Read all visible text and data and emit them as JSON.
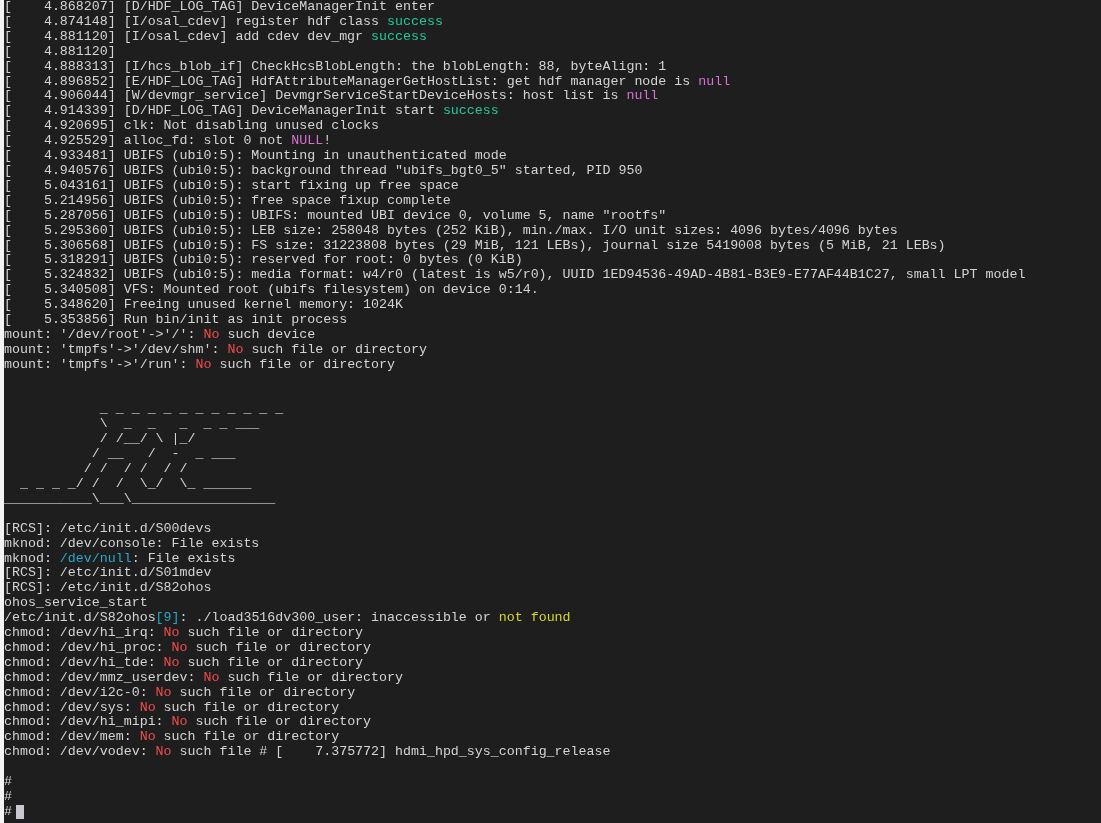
{
  "terminal": {
    "log_lines": [
      {
        "segments": [
          {
            "text": "[    4.868207] [D/HDF_LOG_TAG] DeviceManagerInit enter"
          }
        ]
      },
      {
        "segments": [
          {
            "text": "[    4.874148] [I/osal_cdev] register hdf class "
          },
          {
            "text": "success",
            "color": "#23c99a"
          }
        ]
      },
      {
        "segments": [
          {
            "text": "[    4.881120] [I/osal_cdev] add cdev dev_mgr "
          },
          {
            "text": "success",
            "color": "#23c99a"
          }
        ]
      },
      {
        "segments": [
          {
            "text": "[    4.881120]"
          }
        ]
      },
      {
        "segments": [
          {
            "text": "[    4.888313] [I/hcs_blob_if] CheckHcsBlobLength: the blobLength: 88, byteAlign: 1"
          }
        ]
      },
      {
        "segments": [
          {
            "text": "[    4.896852] [E/HDF_LOG_TAG] HdfAttributeManagerGetHostList: get hdf manager node is "
          },
          {
            "text": "null",
            "color": "#d670d6"
          }
        ]
      },
      {
        "segments": [
          {
            "text": "[    4.906044] [W/devmgr_service] DevmgrServiceStartDeviceHosts: host list is "
          },
          {
            "text": "null",
            "color": "#d670d6"
          }
        ]
      },
      {
        "segments": [
          {
            "text": "[    4.914339] [D/HDF_LOG_TAG] DeviceManagerInit start "
          },
          {
            "text": "success",
            "color": "#23c99a"
          }
        ]
      },
      {
        "segments": [
          {
            "text": "[    4.920695] clk: Not disabling unused clocks"
          }
        ]
      },
      {
        "segments": [
          {
            "text": "[    4.925529] alloc_fd: slot 0 not "
          },
          {
            "text": "NULL",
            "color": "#d670d6"
          },
          {
            "text": "!"
          }
        ]
      },
      {
        "segments": [
          {
            "text": "[    4.933481] UBIFS (ubi0:5): Mounting in unauthenticated mode"
          }
        ]
      },
      {
        "segments": [
          {
            "text": "[    4.940576] UBIFS (ubi0:5): background thread \"ubifs_bgt0_5\" started, PID 950"
          }
        ]
      },
      {
        "segments": [
          {
            "text": "[    5.043161] UBIFS (ubi0:5): start fixing up free space"
          }
        ]
      },
      {
        "segments": [
          {
            "text": "[    5.214956] UBIFS (ubi0:5): free space fixup complete"
          }
        ]
      },
      {
        "segments": [
          {
            "text": "[    5.287056] UBIFS (ubi0:5): UBIFS: mounted UBI device 0, volume 5, name \"rootfs\""
          }
        ]
      },
      {
        "segments": [
          {
            "text": "[    5.295360] UBIFS (ubi0:5): LEB size: 258048 bytes (252 KiB), min./max. I/O unit sizes: 4096 bytes/4096 bytes"
          }
        ]
      },
      {
        "segments": [
          {
            "text": "[    5.306568] UBIFS (ubi0:5): FS size: 31223808 bytes (29 MiB, 121 LEBs), journal size 5419008 bytes (5 MiB, 21 LEBs)"
          }
        ]
      },
      {
        "segments": [
          {
            "text": "[    5.318291] UBIFS (ubi0:5): reserved for root: 0 bytes (0 KiB)"
          }
        ]
      },
      {
        "segments": [
          {
            "text": "[    5.324832] UBIFS (ubi0:5): media format: w4/r0 (latest is w5/r0), UUID 1ED94536-49AD-4B81-B3E9-E77AF44B1C27, small LPT model"
          }
        ]
      },
      {
        "segments": [
          {
            "text": "[    5.340508] VFS: Mounted root (ubifs filesystem) on device 0:14."
          }
        ]
      },
      {
        "segments": [
          {
            "text": "[    5.348620] Freeing unused kernel memory: 1024K"
          }
        ]
      },
      {
        "segments": [
          {
            "text": "[    5.353856] Run bin/init as init process"
          }
        ]
      },
      {
        "segments": [
          {
            "text": "mount: '/dev/root'->'/': "
          },
          {
            "text": "No",
            "color": "#f14c4c"
          },
          {
            "text": " such device"
          }
        ]
      },
      {
        "segments": [
          {
            "text": "mount: 'tmpfs'->'/dev/shm': "
          },
          {
            "text": "No",
            "color": "#f14c4c"
          },
          {
            "text": " such file or directory"
          }
        ]
      },
      {
        "segments": [
          {
            "text": "mount: 'tmpfs'->'/run': "
          },
          {
            "text": "No",
            "color": "#f14c4c"
          },
          {
            "text": " such file or directory"
          }
        ]
      }
    ],
    "banner": [
      "            _ _ _ _ _ _ _ _ _ _ _ _",
      "            \\  _  _   _  _ _ ___",
      "            / /__/ \\ |_/",
      "           / __   /  -  _ ___",
      "          / /  / /  / /",
      "  _ _ _ _/ /  /  \\_/  \\_ ______",
      "___________\\___\\__________________"
    ],
    "init_lines": [
      {
        "segments": [
          {
            "text": "[RCS]: /etc/init.d/S00devs"
          }
        ]
      },
      {
        "segments": [
          {
            "text": "mknod: /dev/console: File exists"
          }
        ]
      },
      {
        "segments": [
          {
            "text": "mknod: "
          },
          {
            "text": "/dev/null",
            "color": "#29a8c8"
          },
          {
            "text": ": File exists"
          }
        ]
      },
      {
        "segments": [
          {
            "text": "[RCS]: /etc/init.d/S01mdev"
          }
        ]
      },
      {
        "segments": [
          {
            "text": "[RCS]: /etc/init.d/S82ohos"
          }
        ]
      },
      {
        "segments": [
          {
            "text": "ohos_service_start"
          }
        ]
      },
      {
        "segments": [
          {
            "text": "/etc/init.d/S82ohos"
          },
          {
            "text": "[9]",
            "color": "#29a8c8"
          },
          {
            "text": ": ./load3516dv300_user: inaccessible or "
          },
          {
            "text": "not found",
            "color": "#d7d72a"
          }
        ]
      },
      {
        "segments": [
          {
            "text": "chmod: /dev/hi_irq: "
          },
          {
            "text": "No",
            "color": "#f14c4c"
          },
          {
            "text": " such file or directory"
          }
        ]
      },
      {
        "segments": [
          {
            "text": "chmod: /dev/hi_proc: "
          },
          {
            "text": "No",
            "color": "#f14c4c"
          },
          {
            "text": " such file or directory"
          }
        ]
      },
      {
        "segments": [
          {
            "text": "chmod: /dev/hi_tde: "
          },
          {
            "text": "No",
            "color": "#f14c4c"
          },
          {
            "text": " such file or directory"
          }
        ]
      },
      {
        "segments": [
          {
            "text": "chmod: /dev/mmz_userdev: "
          },
          {
            "text": "No",
            "color": "#f14c4c"
          },
          {
            "text": " such file or directory"
          }
        ]
      },
      {
        "segments": [
          {
            "text": "chmod: /dev/i2c-0: "
          },
          {
            "text": "No",
            "color": "#f14c4c"
          },
          {
            "text": " such file or directory"
          }
        ]
      },
      {
        "segments": [
          {
            "text": "chmod: /dev/sys: "
          },
          {
            "text": "No",
            "color": "#f14c4c"
          },
          {
            "text": " such file or directory"
          }
        ]
      },
      {
        "segments": [
          {
            "text": "chmod: /dev/hi_mipi: "
          },
          {
            "text": "No",
            "color": "#f14c4c"
          },
          {
            "text": " such file or directory"
          }
        ]
      },
      {
        "segments": [
          {
            "text": "chmod: /dev/mem: "
          },
          {
            "text": "No",
            "color": "#f14c4c"
          },
          {
            "text": " such file or directory"
          }
        ]
      },
      {
        "segments": [
          {
            "text": "chmod: /dev/vodev: "
          },
          {
            "text": "No",
            "color": "#f14c4c"
          },
          {
            "text": " such file # [    7.375772] hdmi_hpd_sys_config_release"
          }
        ]
      }
    ],
    "prompt_lines": [
      {
        "text": "#",
        "cursor": false
      },
      {
        "text": "#",
        "cursor": false
      },
      {
        "text": "#",
        "cursor": true
      }
    ]
  }
}
